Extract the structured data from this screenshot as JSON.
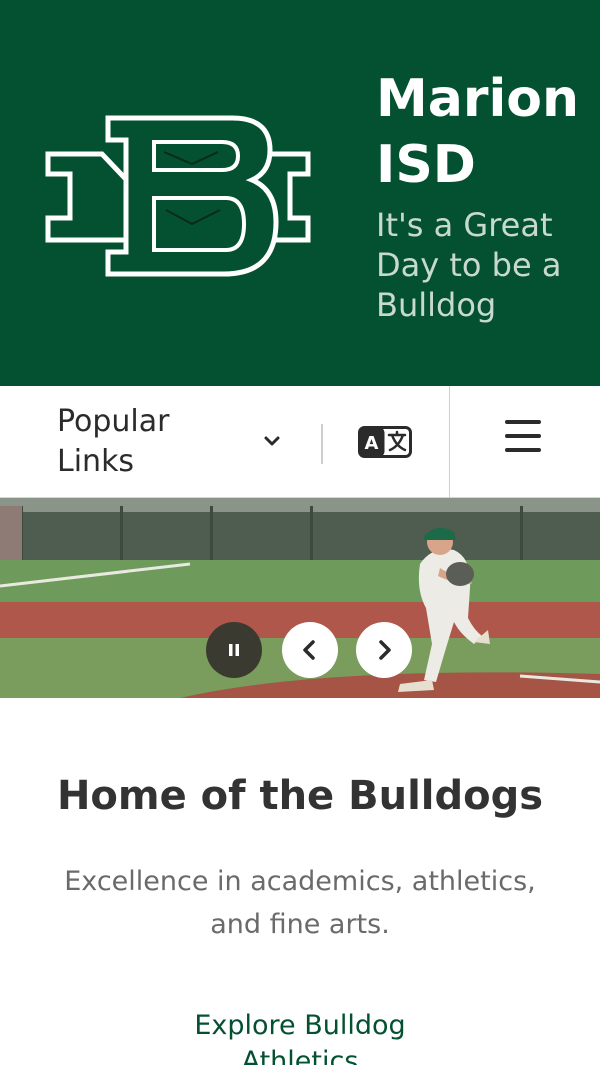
{
  "header": {
    "site_title": "Marion ISD",
    "tagline": "It's a Great Day to be a Bulldog",
    "logo_icon": "mb-monogram-logo"
  },
  "nav": {
    "popular_links_label": "Popular Links",
    "translate_icon": "translate-icon",
    "menu_icon": "hamburger-menu-icon"
  },
  "hero": {
    "image_subject": "baseball-pitcher-photo",
    "controls": {
      "pause_icon": "pause-icon",
      "prev_icon": "chevron-left-icon",
      "next_icon": "chevron-right-icon"
    }
  },
  "main": {
    "headline": "Home of the Bulldogs",
    "subline": "Excellence in academics, athletics, and fine arts.",
    "link_label": "Explore Bulldog Athletics"
  },
  "colors": {
    "brand_green": "#045132",
    "tagline_text": "#c8d9cf",
    "pause_button": "#3b3a30",
    "body_text": "#333333"
  }
}
